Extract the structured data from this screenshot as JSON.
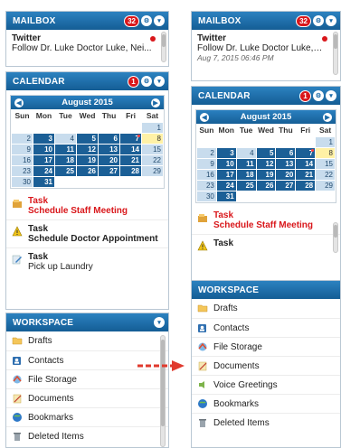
{
  "left": {
    "mailbox": {
      "title": "MAILBOX",
      "badge": "32",
      "from": "Twitter",
      "subject": "Follow Dr. Luke Doctor Luke, Nei..."
    },
    "calendar": {
      "title": "CALENDAR",
      "badge": "1",
      "month": "August 2015",
      "weekdays": [
        "Sun",
        "Mon",
        "Tue",
        "Wed",
        "Thu",
        "Fri",
        "Sat"
      ],
      "tasks": [
        {
          "type": "Task",
          "desc": "Schedule Staff Meeting",
          "icon": "task-icon"
        },
        {
          "type": "Task",
          "desc": "Schedule Doctor Appointment",
          "icon": "warning-icon"
        },
        {
          "type": "Task",
          "desc": "Pick up Laundry",
          "icon": "pencil-icon"
        }
      ]
    },
    "workspace": {
      "title": "WORKSPACE",
      "items": [
        {
          "label": "Drafts",
          "icon": "folder-icon"
        },
        {
          "label": "Contacts",
          "icon": "contacts-icon"
        },
        {
          "label": "File Storage",
          "icon": "file-storage-icon"
        },
        {
          "label": "Documents",
          "icon": "documents-icon"
        },
        {
          "label": "Bookmarks",
          "icon": "bookmarks-icon"
        },
        {
          "label": "Deleted Items",
          "icon": "trash-icon"
        }
      ]
    }
  },
  "right": {
    "mailbox": {
      "title": "MAILBOX",
      "badge": "32",
      "from": "Twitter",
      "subject": "Follow Dr. Luke Doctor Luke, Nei...",
      "date": "Aug 7, 2015 06:46 PM"
    },
    "calendar": {
      "title": "CALENDAR",
      "badge": "1",
      "month": "August 2015",
      "weekdays": [
        "Sun",
        "Mon",
        "Tue",
        "Wed",
        "Thu",
        "Fri",
        "Sat"
      ],
      "tasks": [
        {
          "type": "Task",
          "desc": "Schedule Staff Meeting",
          "icon": "task-icon"
        },
        {
          "type": "Task",
          "desc": "",
          "icon": "warning-icon"
        }
      ]
    },
    "workspace": {
      "title": "WORKSPACE",
      "items": [
        {
          "label": "Drafts",
          "icon": "folder-icon"
        },
        {
          "label": "Contacts",
          "icon": "contacts-icon"
        },
        {
          "label": "File Storage",
          "icon": "file-storage-icon"
        },
        {
          "label": "Documents",
          "icon": "documents-icon"
        },
        {
          "label": "Voice Greetings",
          "icon": "voice-greetings-icon"
        },
        {
          "label": "Bookmarks",
          "icon": "bookmarks-icon"
        },
        {
          "label": "Deleted Items",
          "icon": "trash-icon"
        }
      ]
    }
  },
  "calendar_days": {
    "weeks": [
      [
        "",
        "",
        "",
        "",
        "",
        "",
        "1"
      ],
      [
        "2",
        "3",
        "4",
        "5",
        "6",
        "7",
        "8"
      ],
      [
        "9",
        "10",
        "11",
        "12",
        "13",
        "14",
        "15"
      ],
      [
        "16",
        "17",
        "18",
        "19",
        "20",
        "21",
        "22"
      ],
      [
        "23",
        "24",
        "25",
        "26",
        "27",
        "28",
        "29"
      ],
      [
        "30",
        "31",
        "",
        "",
        "",
        "",
        ""
      ]
    ],
    "event_days": [
      "3",
      "5",
      "6",
      "7",
      "10",
      "11",
      "12",
      "13",
      "14",
      "17",
      "18",
      "19",
      "20",
      "21",
      "24",
      "25",
      "26",
      "27",
      "28",
      "31"
    ],
    "today": "8",
    "flagged_day": "7"
  },
  "colors": {
    "header_blue": "#1b6aa8",
    "badge_red": "#d9171b",
    "event_blue": "#1b5f96",
    "today_yellow": "#fff1a6",
    "arrow_red": "#e03a2e"
  }
}
